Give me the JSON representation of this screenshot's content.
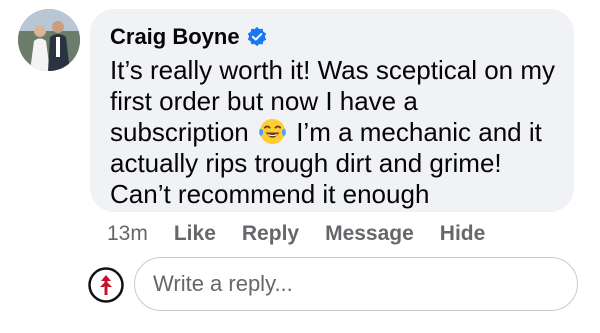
{
  "comment": {
    "author": "Craig Boyne",
    "verified_icon": "verified-badge-icon",
    "text_lines": [
      "It’s really worth it! Was sceptical on my",
      "first order but now I have a",
      "subscription",
      "I’m a mechanic and it",
      "actually rips trough dirt and grime!",
      "Can’t recommend it enough"
    ],
    "emoji": "tears-of-joy-emoji-icon"
  },
  "actions": {
    "timestamp": "13m",
    "like": "Like",
    "reply": "Reply",
    "message": "Message",
    "hide": "Hide"
  },
  "reply_box": {
    "placeholder": "Write a reply..."
  },
  "colors": {
    "bubble": "#f0f2f5",
    "verified": "#1877f2",
    "muted_text": "#65676b",
    "brand_red": "#c8102e"
  }
}
